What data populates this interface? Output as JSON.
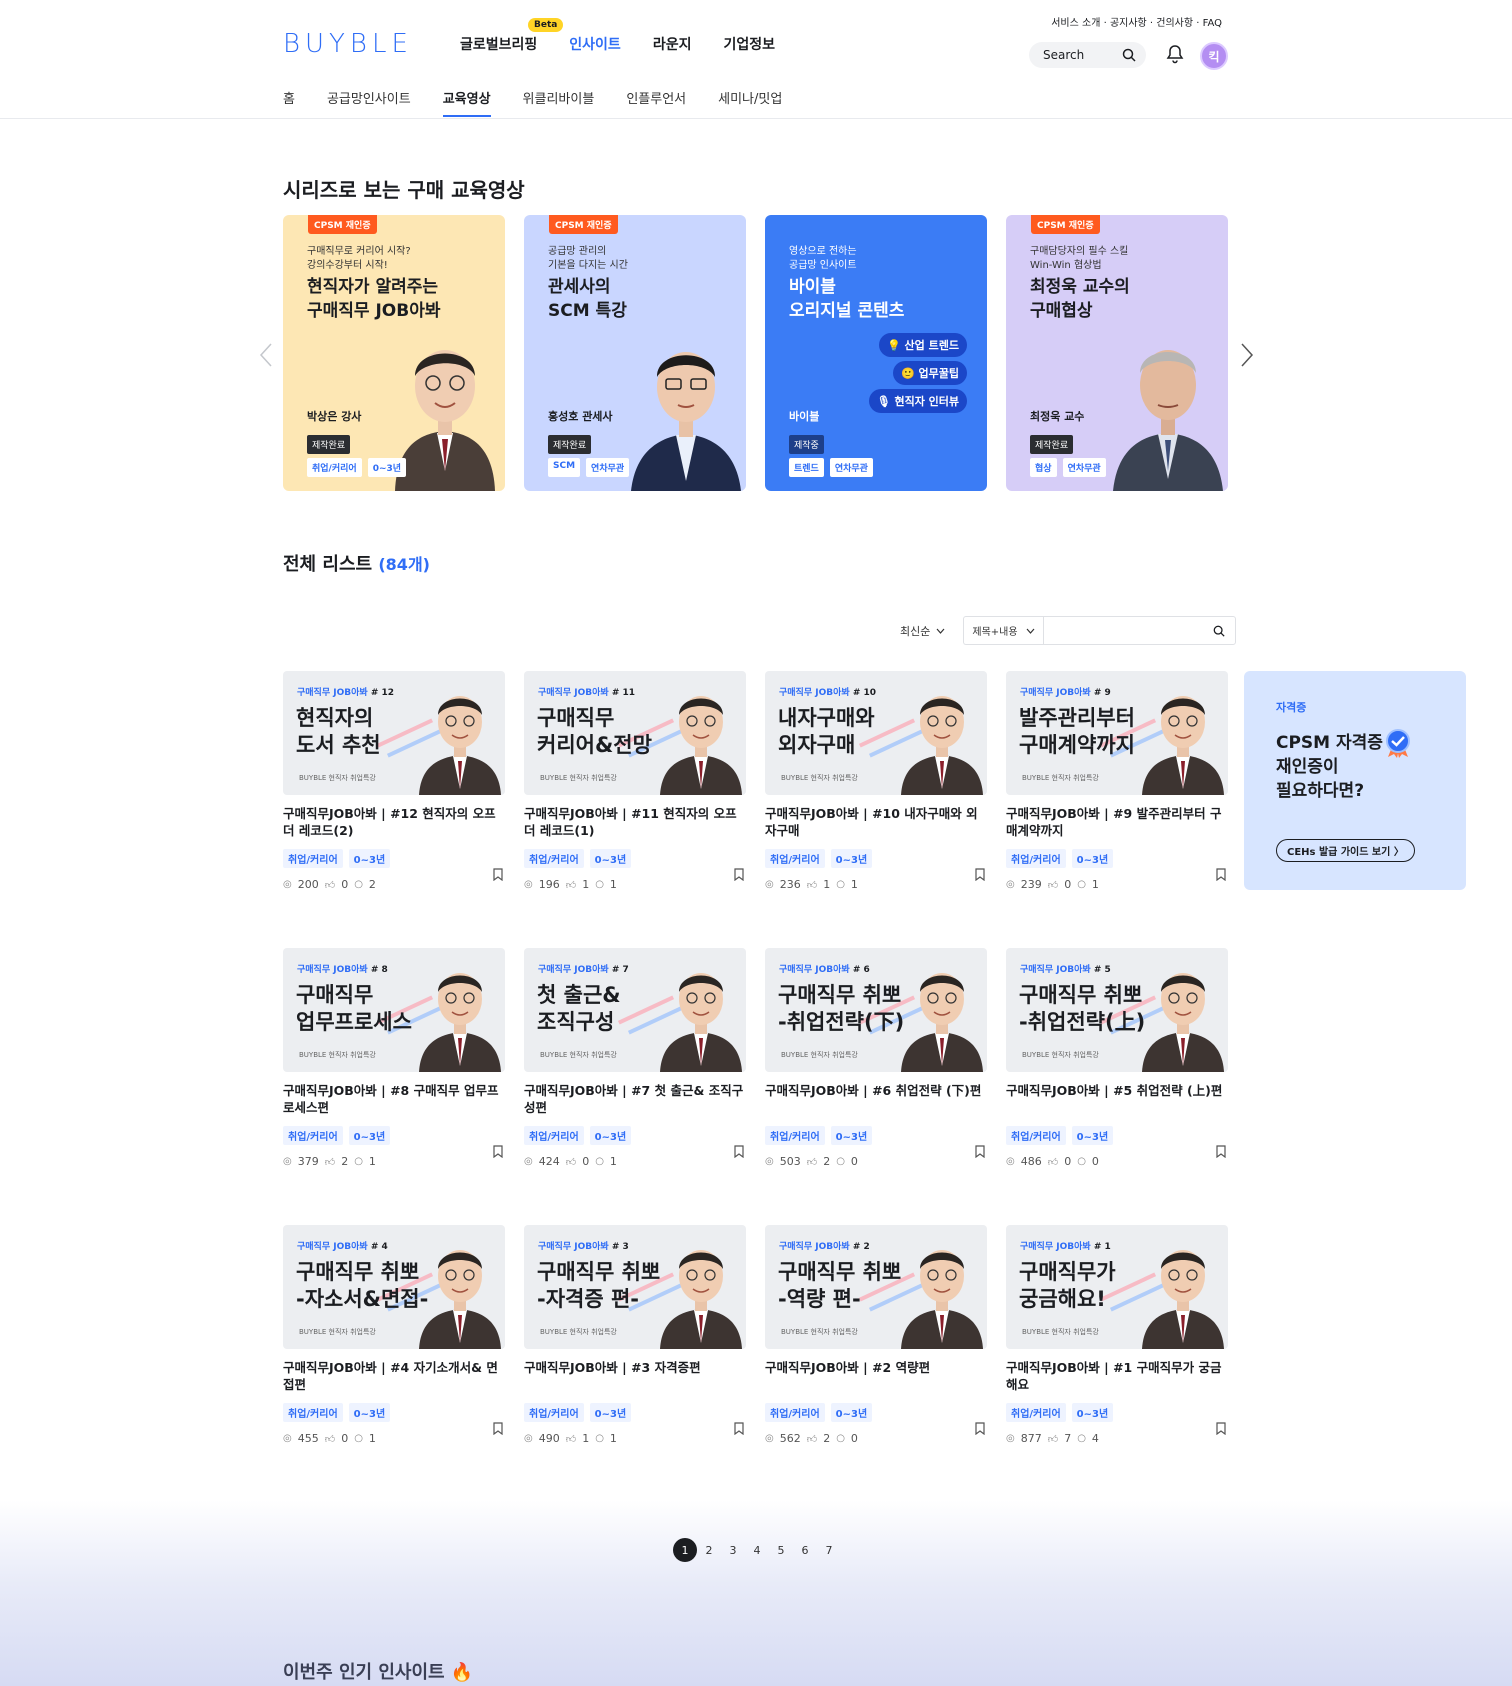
{
  "header": {
    "logo": "BUYBLE",
    "gnb": [
      {
        "label": "글로벌브리핑",
        "beta": "Beta"
      },
      {
        "label": "인사이트"
      },
      {
        "label": "라운지"
      },
      {
        "label": "기업정보"
      }
    ],
    "util_links": "서비스 소개 · 공지사항 · 건의사항 · FAQ",
    "search_placeholder": "Search",
    "avatar_initial": "킥",
    "lnb": [
      "홈",
      "공급망인사이트",
      "교육영상",
      "위클리바이블",
      "인플루언서",
      "세미나/밋업"
    ]
  },
  "series": {
    "title": "시리즈로 보는 구매 교육영상",
    "cards": [
      {
        "badge": "CPSM 재인증",
        "sub": "구매직무로 커리어 시작?\n강의수강부터 시작!",
        "title": "현직자가 알려주는\n구매직무 JOB아봐",
        "person": "박상은 강사",
        "status": "제작완료",
        "tags": [
          "취업/커리어",
          "0~3년"
        ],
        "bg": "#fde7b4"
      },
      {
        "badge": "CPSM 재인증",
        "sub": "공급망 관리의\n기본을 다지는 시간",
        "title": "관세사의\nSCM 특강",
        "person": "홍성호 관세사",
        "status": "제작완료",
        "tags": [
          "SCM",
          "연차무관"
        ],
        "bg": "#c9d6ff"
      },
      {
        "badge": "",
        "sub": "영상으로 전하는\n공급망 인사이트",
        "title": "바이블\n오리지널 콘텐츠",
        "person": "바이블",
        "status": "제작중",
        "tags": [
          "트렌드",
          "연차무관"
        ],
        "bg": "#3b7cf5",
        "pills": [
          "💡 산업 트렌드",
          "🙂 업무꿀팁",
          "🎙 현직자 인터뷰"
        ]
      },
      {
        "badge": "CPSM 재인증",
        "sub": "구매담당자의 필수 스킬\nWin-Win 협상법",
        "title": "최정욱 교수의\n구매협상",
        "person": "최정욱 교수",
        "status": "제작완료",
        "tags": [
          "협상",
          "연차무관"
        ],
        "bg": "#d6cdf7"
      }
    ]
  },
  "list": {
    "title": "전체 리스트",
    "count": "(84개)",
    "sort": "최신순",
    "search_scope": "제목+내용",
    "videos": [
      {
        "series": "구매직무 JOB아봐",
        "no": "# 12",
        "thumb": "현직자의\n도서 추천",
        "title": "구매직무JOB아봐 | #12 현직자의 오프더 레코드(2)",
        "tags": [
          "취업/커리어",
          "0~3년"
        ],
        "views": "200",
        "likes": "0",
        "comments": "2"
      },
      {
        "series": "구매직무 JOB아봐",
        "no": "# 11",
        "thumb": "구매직무\n커리어&전망",
        "title": "구매직무JOB아봐 | #11 현직자의 오프더 레코드(1)",
        "tags": [
          "취업/커리어",
          "0~3년"
        ],
        "views": "196",
        "likes": "1",
        "comments": "1"
      },
      {
        "series": "구매직무 JOB아봐",
        "no": "# 10",
        "thumb": "내자구매와\n외자구매",
        "title": "구매직무JOB아봐 | #10 내자구매와 외자구매",
        "tags": [
          "취업/커리어",
          "0~3년"
        ],
        "views": "236",
        "likes": "1",
        "comments": "1"
      },
      {
        "series": "구매직무 JOB아봐",
        "no": "# 9",
        "thumb": "발주관리부터\n구매계약까지",
        "title": "구매직무JOB아봐 | #9 발주관리부터 구매계약까지",
        "tags": [
          "취업/커리어",
          "0~3년"
        ],
        "views": "239",
        "likes": "0",
        "comments": "1"
      },
      {
        "series": "구매직무 JOB아봐",
        "no": "# 8",
        "thumb": "구매직무\n업무프로세스",
        "title": "구매직무JOB아봐 | #8 구매직무 업무프로세스편",
        "tags": [
          "취업/커리어",
          "0~3년"
        ],
        "views": "379",
        "likes": "2",
        "comments": "1"
      },
      {
        "series": "구매직무 JOB아봐",
        "no": "# 7",
        "thumb": "첫 출근&\n조직구성",
        "title": "구매직무JOB아봐 | #7 첫 출근& 조직구성편",
        "tags": [
          "취업/커리어",
          "0~3년"
        ],
        "views": "424",
        "likes": "0",
        "comments": "1"
      },
      {
        "series": "구매직무 JOB아봐",
        "no": "# 6",
        "thumb": "구매직무 취뽀\n-취업전략(下)",
        "title": "구매직무JOB아봐 | #6 취업전략 (下)편",
        "tags": [
          "취업/커리어",
          "0~3년"
        ],
        "views": "503",
        "likes": "2",
        "comments": "0"
      },
      {
        "series": "구매직무 JOB아봐",
        "no": "# 5",
        "thumb": "구매직무 취뽀\n-취업전략(上)",
        "title": "구매직무JOB아봐 | #5 취업전략 (上)편",
        "tags": [
          "취업/커리어",
          "0~3년"
        ],
        "views": "486",
        "likes": "0",
        "comments": "0"
      },
      {
        "series": "구매직무 JOB아봐",
        "no": "# 4",
        "thumb": "구매직무 취뽀\n-자소서&면접-",
        "title": "구매직무JOB아봐 | #4 자기소개서& 면접편",
        "tags": [
          "취업/커리어",
          "0~3년"
        ],
        "views": "455",
        "likes": "0",
        "comments": "1"
      },
      {
        "series": "구매직무 JOB아봐",
        "no": "# 3",
        "thumb": "구매직무 취뽀\n-자격증 편-",
        "title": "구매직무JOB아봐 | #3 자격증편",
        "tags": [
          "취업/커리어",
          "0~3년"
        ],
        "views": "490",
        "likes": "1",
        "comments": "1"
      },
      {
        "series": "구매직무 JOB아봐",
        "no": "# 2",
        "thumb": "구매직무 취뽀\n-역량 편-",
        "title": "구매직무JOB아봐 | #2 역량편",
        "tags": [
          "취업/커리어",
          "0~3년"
        ],
        "views": "562",
        "likes": "2",
        "comments": "0"
      },
      {
        "series": "구매직무 JOB아봐",
        "no": "# 1",
        "thumb": "구매직무가\n궁금해요!",
        "title": "구매직무JOB아봐 | #1 구매직무가 궁금해요",
        "tags": [
          "취업/커리어",
          "0~3년"
        ],
        "views": "877",
        "likes": "7",
        "comments": "4"
      }
    ],
    "thumb_footer": "BUYBLE 현직자 취업특강",
    "banner": {
      "category": "자격증",
      "message": "CPSM 자격증\n재인증이\n필요하다면?",
      "button": "CEHs 발급 가이드 보기  〉"
    }
  },
  "pagination": [
    "1",
    "2",
    "3",
    "4",
    "5",
    "6",
    "7"
  ],
  "footer_section_title": "이번주 인기 인사이트 🔥",
  "colors": {
    "accent": "#2f6df6",
    "badge": "#ff5a1f"
  }
}
